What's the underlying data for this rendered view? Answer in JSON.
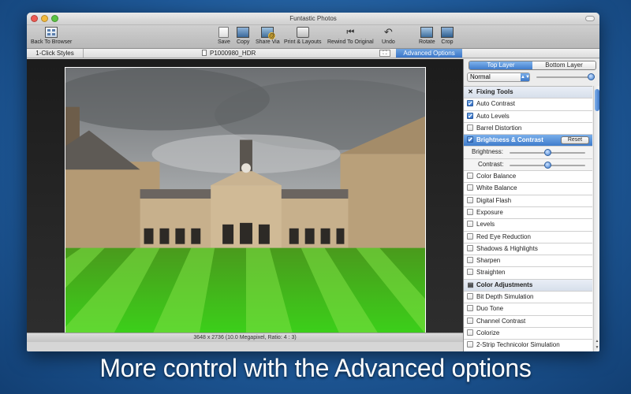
{
  "window": {
    "title": "Funtastic Photos"
  },
  "toolbar": {
    "back": "Back To Browser",
    "save": "Save",
    "copy": "Copy",
    "share": "Share Via",
    "print": "Print & Layouts",
    "rewind": "Rewind To Original",
    "undo": "Undo",
    "rotate": "Rotate",
    "crop": "Crop"
  },
  "tabs": {
    "one_click": "1-Click Styles",
    "file_name": "P1000980_HDR",
    "advanced": "Advanced Options"
  },
  "status": {
    "info": "3648 x 2736 (10.0 Megapixel, Ratio: 4 : 3)"
  },
  "panel": {
    "layer_tabs": [
      "Top Layer",
      "Bottom Layer"
    ],
    "active_layer": "Top Layer",
    "blend_mode": "Normal",
    "opacity": 1.0,
    "fixing_tools": "Fixing Tools",
    "color_adjustments": "Color Adjustments",
    "reset_label": "Reset",
    "brightness_label": "Brightness:",
    "contrast_label": "Contrast:",
    "brightness": 0.5,
    "contrast": 0.5,
    "fixing_items": [
      {
        "label": "Auto Contrast",
        "checked": true
      },
      {
        "label": "Auto Levels",
        "checked": true
      },
      {
        "label": "Barrel Distortion",
        "checked": false
      },
      {
        "label": "Brightness & Contrast",
        "checked": true
      }
    ],
    "more_fixing": [
      {
        "label": "Color Balance",
        "checked": false
      },
      {
        "label": "White Balance",
        "checked": false
      },
      {
        "label": "Digital Flash",
        "checked": false
      },
      {
        "label": "Exposure",
        "checked": false
      },
      {
        "label": "Levels",
        "checked": false
      },
      {
        "label": "Red Eye Reduction",
        "checked": false
      },
      {
        "label": "Shadows & Highlights",
        "checked": false
      },
      {
        "label": "Sharpen",
        "checked": false
      },
      {
        "label": "Straighten",
        "checked": false
      }
    ],
    "color_items": [
      {
        "label": "Bit Depth Simulation",
        "checked": false
      },
      {
        "label": "Duo Tone",
        "checked": false
      },
      {
        "label": "Channel Contrast",
        "checked": false
      },
      {
        "label": "Colorize",
        "checked": false
      },
      {
        "label": "2-Strip Technicolor Simulation",
        "checked": false
      }
    ]
  },
  "caption": "More control with the Advanced options",
  "colors": {
    "accent": "#3f7ccc",
    "background": "#1f5a9a"
  }
}
